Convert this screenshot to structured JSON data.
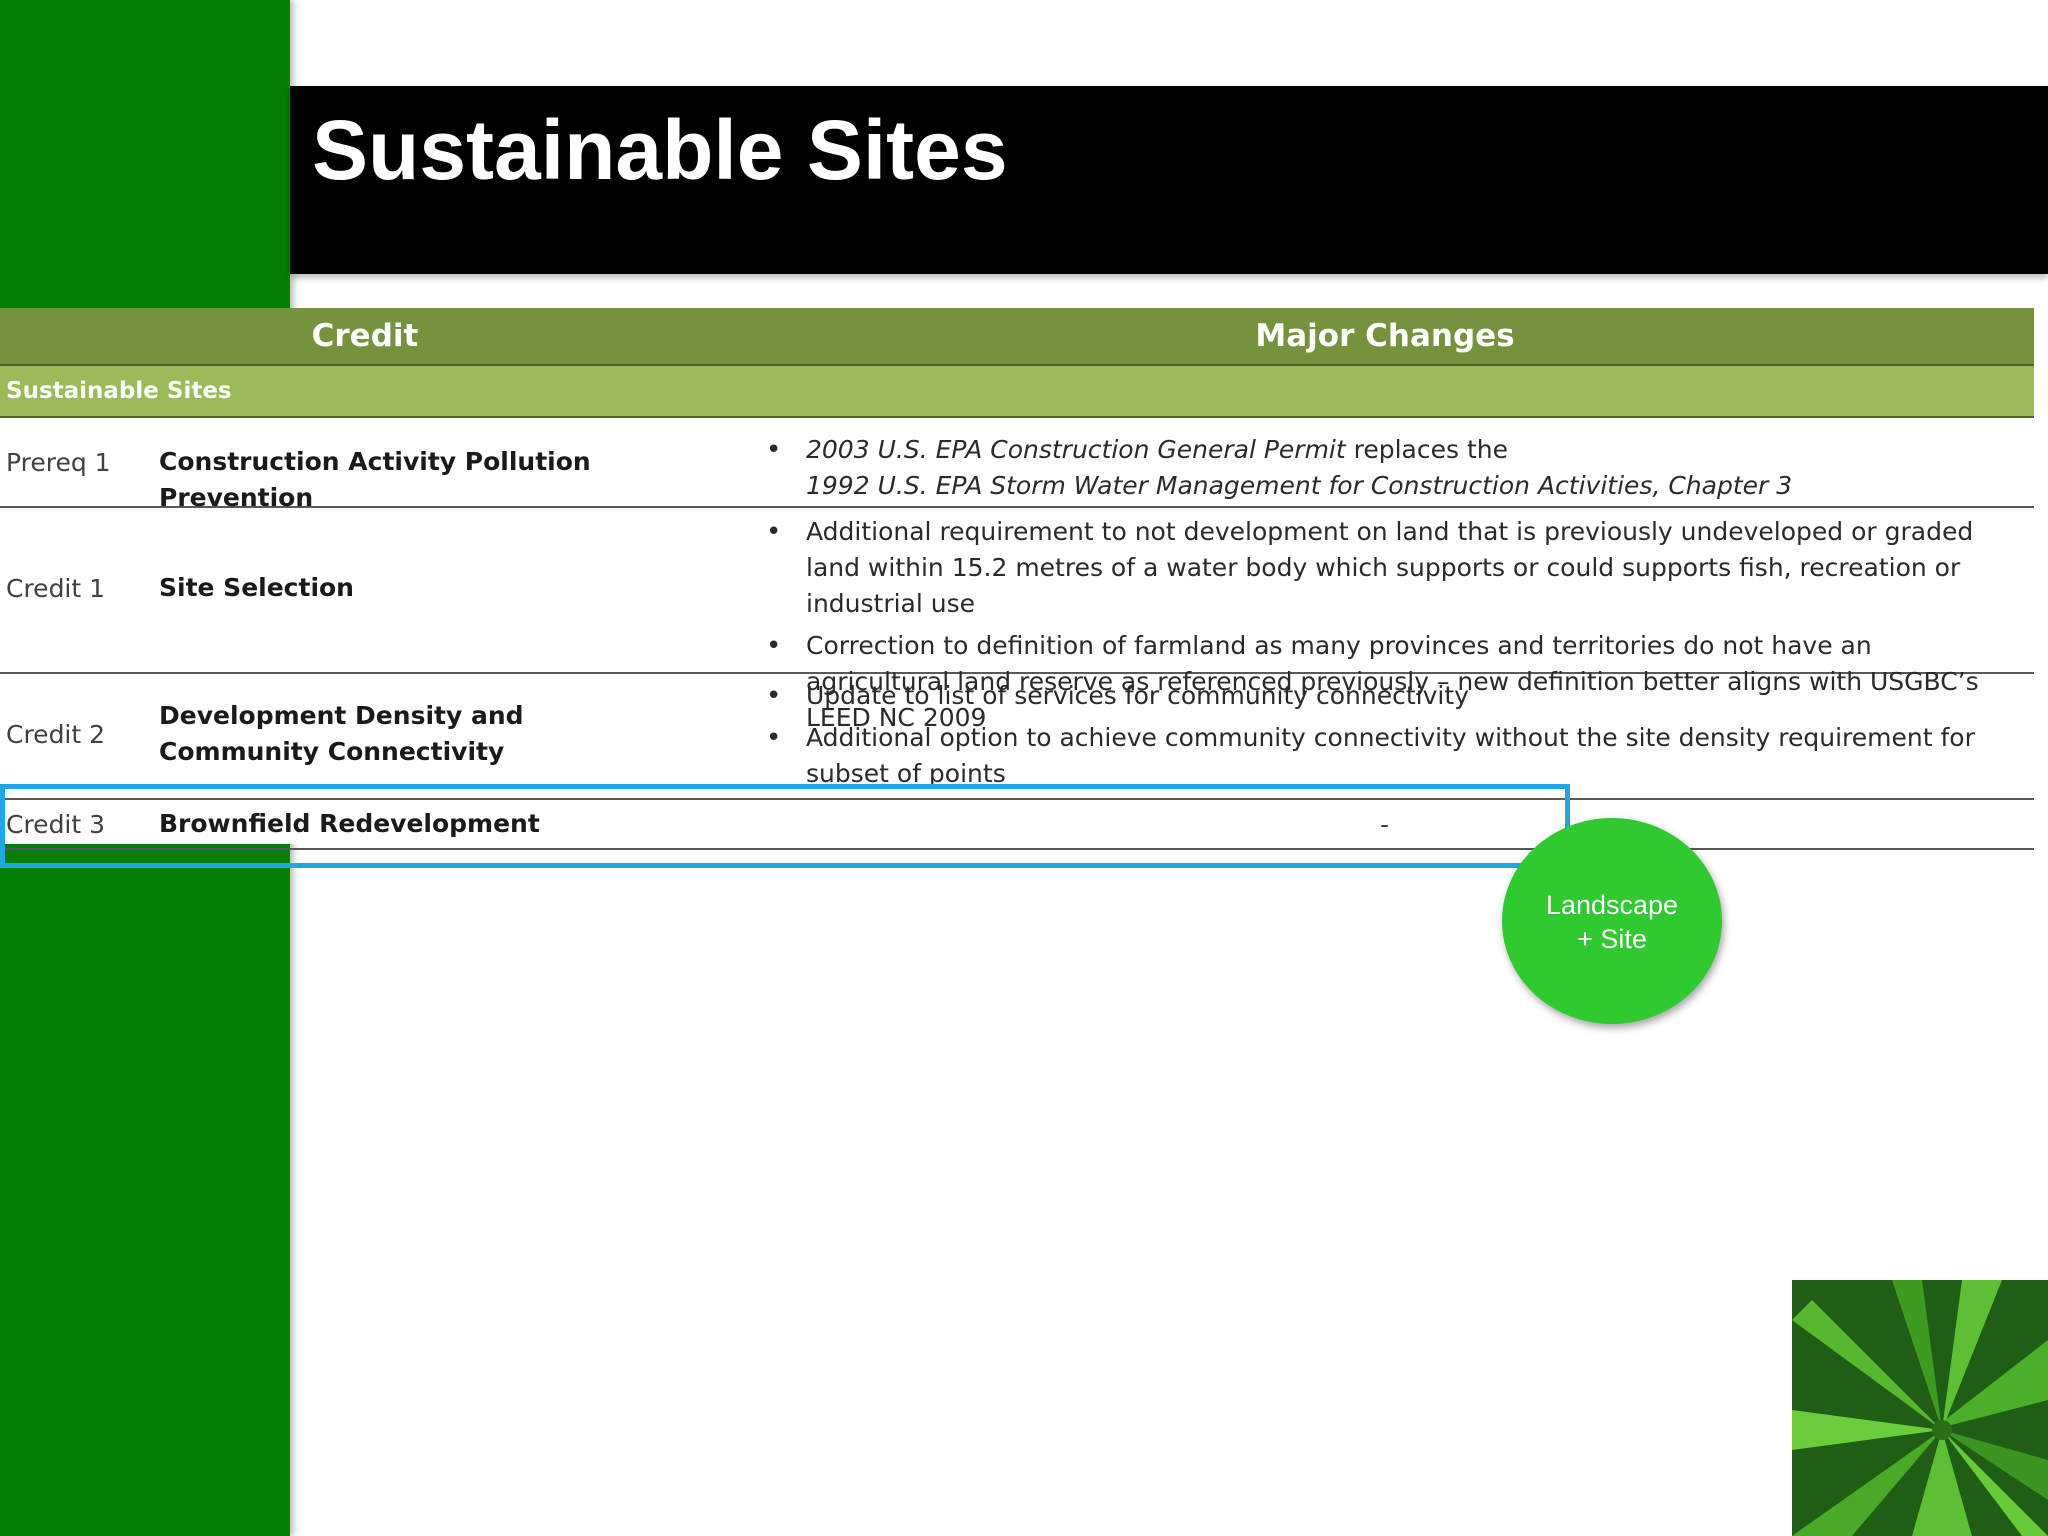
{
  "slide": {
    "title": "Sustainable Sites"
  },
  "table": {
    "headers": {
      "credit": "Credit",
      "changes": "Major Changes"
    },
    "section": "Sustainable Sites",
    "rows": [
      {
        "id": "Prereq 1",
        "name": "Construction Activity Pollution Prevention",
        "changes": [
          {
            "italic1": "2003 U.S. EPA Construction General Permit",
            "normal": " replaces the",
            "italic2": "1992 U.S. EPA Storm Water Management for Construction Activities, Chapter 3"
          }
        ]
      },
      {
        "id": "Credit 1",
        "name": "Site Selection",
        "changes": [
          "Additional requirement to not development on land that is previously undeveloped or graded land within 15.2 metres of a water body which supports or could supports fish, recreation or industrial use",
          "Correction to definition of farmland as many provinces and territories do not have an agricultural land reserve as referenced previously – new definition better aligns with USGBC’s LEED NC 2009"
        ]
      },
      {
        "id": "Credit 2",
        "name": "Development Density and Community Connectivity",
        "changes": [
          "Update to list of services for community connectivity",
          "Additional option to achieve community connectivity without the site density requirement for subset of points"
        ]
      },
      {
        "id": "Credit 3",
        "name": "Brownfield Redevelopment",
        "changes_text": "-"
      }
    ]
  },
  "badge": {
    "line1": "Landscape",
    "line2": "+ Site"
  },
  "colors": {
    "left_bar": "#037f03",
    "header_green": "#76923c",
    "section_green": "#9bbb59",
    "highlight_blue": "#1fa7e1",
    "badge_green": "#2fca2f"
  }
}
